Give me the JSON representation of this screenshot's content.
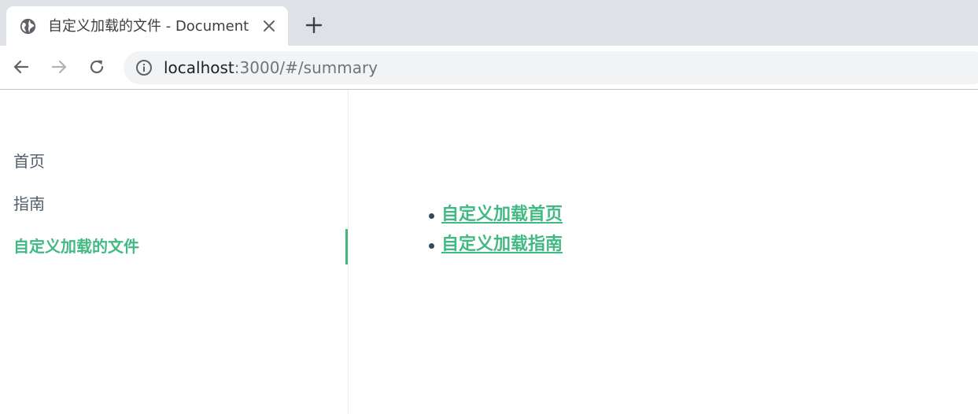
{
  "browser": {
    "tab_title": "自定义加载的文件 - Document",
    "url_host": "localhost",
    "url_rest": ":3000/#/summary"
  },
  "sidebar": {
    "items": [
      {
        "label": "首页",
        "active": false
      },
      {
        "label": "指南",
        "active": false
      },
      {
        "label": "自定义加载的文件",
        "active": true
      }
    ]
  },
  "content": {
    "links": [
      {
        "label": "自定义加载首页"
      },
      {
        "label": "自定义加载指南"
      }
    ]
  },
  "colors": {
    "accent": "#42b983",
    "text": "#34495e",
    "tabstrip": "#dee1e6"
  }
}
